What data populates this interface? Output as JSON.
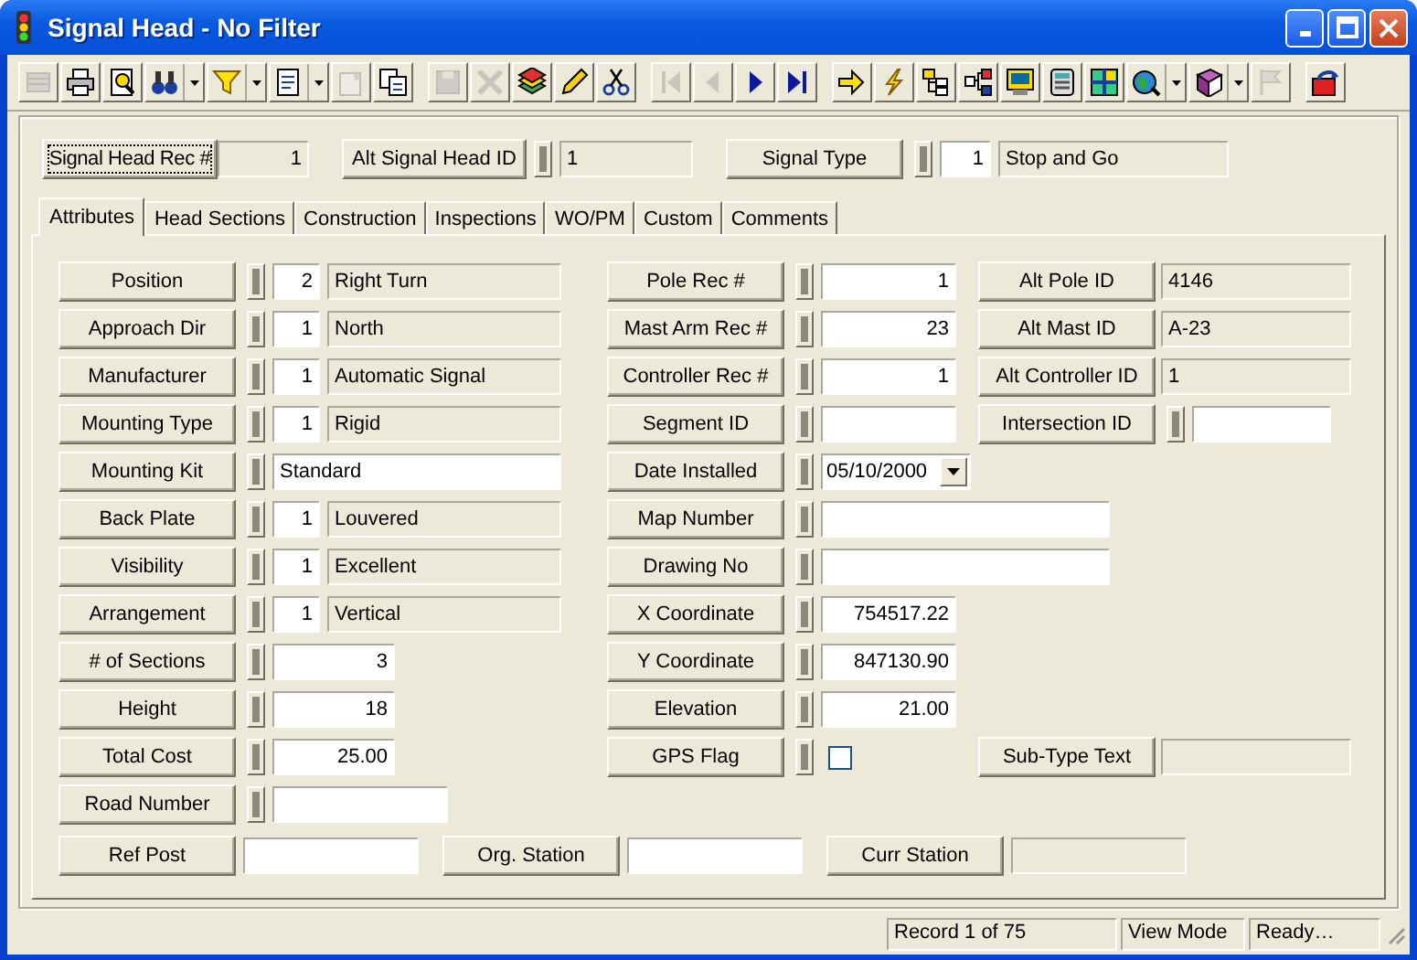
{
  "window": {
    "title": "Signal Head - No Filter"
  },
  "toolbar": [
    [
      {
        "disabled": true,
        "dropdown": false
      },
      {
        "disabled": false,
        "dropdown": false
      },
      {
        "disabled": false,
        "dropdown": false
      },
      {
        "disabled": false,
        "dropdown": true
      },
      {
        "disabled": false,
        "dropdown": true
      },
      {
        "disabled": false,
        "dropdown": true
      },
      {
        "disabled": true,
        "dropdown": false
      },
      {
        "disabled": false,
        "dropdown": false
      }
    ],
    [
      {
        "disabled": true,
        "dropdown": false
      },
      {
        "disabled": true,
        "dropdown": false
      },
      {
        "disabled": false,
        "dropdown": false
      },
      {
        "disabled": false,
        "dropdown": false
      },
      {
        "disabled": false,
        "dropdown": false
      }
    ],
    [
      {
        "disabled": true,
        "dropdown": false
      },
      {
        "disabled": true,
        "dropdown": false
      },
      {
        "disabled": false,
        "dropdown": false
      },
      {
        "disabled": false,
        "dropdown": false
      }
    ],
    [
      {
        "disabled": false,
        "dropdown": false
      },
      {
        "disabled": false,
        "dropdown": false
      },
      {
        "disabled": false,
        "dropdown": false
      },
      {
        "disabled": false,
        "dropdown": false
      },
      {
        "disabled": false,
        "dropdown": false
      },
      {
        "disabled": false,
        "dropdown": false
      },
      {
        "disabled": false,
        "dropdown": false
      },
      {
        "disabled": false,
        "dropdown": true
      },
      {
        "disabled": false,
        "dropdown": true
      },
      {
        "disabled": true,
        "dropdown": false
      }
    ],
    [
      {
        "disabled": false,
        "dropdown": false
      }
    ]
  ],
  "header": {
    "record": {
      "label": "Signal Head Rec #",
      "focused": true,
      "value": "1"
    },
    "alt_id": {
      "label": "Alt Signal Head  ID",
      "value": "1"
    },
    "signal_type": {
      "label": "Signal Type",
      "code": "1",
      "description": "Stop and Go"
    }
  },
  "tabs": [
    {
      "label": "Attributes",
      "selected": true
    },
    {
      "label": "Head Sections",
      "selected": false
    },
    {
      "label": "Construction",
      "selected": false
    },
    {
      "label": "Inspections",
      "selected": false
    },
    {
      "label": "WO/PM",
      "selected": false
    },
    {
      "label": "Custom",
      "selected": false
    },
    {
      "label": "Comments",
      "selected": false
    }
  ],
  "rows": [
    {
      "left": {
        "kind": "lookup",
        "label": "Position",
        "code": "2",
        "description": "Right Turn"
      },
      "middle": {
        "kind": "number",
        "label": "Pole Rec #",
        "value": "1"
      },
      "right": {
        "kind": "display",
        "label": "Alt Pole ID",
        "value": "4146"
      }
    },
    {
      "left": {
        "kind": "lookup",
        "label": "Approach Dir",
        "code": "1",
        "description": "North"
      },
      "middle": {
        "kind": "number",
        "label": "Mast Arm Rec #",
        "value": "23"
      },
      "right": {
        "kind": "display",
        "label": "Alt Mast ID",
        "value": "A-23"
      }
    },
    {
      "left": {
        "kind": "lookup",
        "label": "Manufacturer",
        "code": "1",
        "description": "Automatic Signal"
      },
      "middle": {
        "kind": "number",
        "label": "Controller Rec #",
        "value": "1"
      },
      "right": {
        "kind": "display",
        "label": "Alt Controller ID",
        "value": "1"
      }
    },
    {
      "left": {
        "kind": "lookup",
        "label": "Mounting Type",
        "code": "1",
        "description": "Rigid"
      },
      "middle": {
        "kind": "number",
        "label": "Segment ID"
      },
      "right": {
        "kind": "input",
        "label": "Intersection ID"
      }
    },
    {
      "left": {
        "kind": "text",
        "label": "Mounting Kit",
        "value": "Standard"
      },
      "middle": {
        "kind": "date",
        "label": "Date Installed",
        "value": "05/10/2000"
      }
    },
    {
      "left": {
        "kind": "lookup",
        "label": "Back Plate",
        "code": "1",
        "description": "Louvered"
      },
      "middle": {
        "kind": "text",
        "label": "Map Number"
      }
    },
    {
      "left": {
        "kind": "lookup",
        "label": "Visibility",
        "code": "1",
        "description": "Excellent"
      },
      "middle": {
        "kind": "text",
        "label": "Drawing No"
      }
    },
    {
      "left": {
        "kind": "lookup",
        "label": "Arrangement",
        "code": "1",
        "description": "Vertical"
      },
      "middle": {
        "kind": "number",
        "label": "X Coordinate",
        "value": "754517.22"
      }
    },
    {
      "left": {
        "kind": "number",
        "label": "# of Sections",
        "value": "3"
      },
      "middle": {
        "kind": "number",
        "label": "Y Coordinate",
        "value": "847130.90"
      }
    },
    {
      "left": {
        "kind": "number",
        "label": "Height",
        "value": "18"
      },
      "middle": {
        "kind": "number",
        "label": "Elevation",
        "value": "21.00"
      }
    },
    {
      "left": {
        "kind": "number",
        "label": "Total Cost",
        "value": "25.00"
      },
      "middle": {
        "kind": "checkbox",
        "label": "GPS Flag",
        "checked": false
      },
      "right": {
        "kind": "display",
        "label": "Sub-Type Text"
      }
    },
    {
      "left": {
        "kind": "medium",
        "label": "Road Number"
      }
    }
  ],
  "bottom_fields": [
    {
      "label": "Ref Post",
      "readonly": false
    },
    {
      "label": "Org. Station",
      "readonly": false
    },
    {
      "label": "Curr Station",
      "readonly": true
    }
  ],
  "status_bar": [
    "Record 1 of 75",
    "View Mode",
    "Ready…"
  ]
}
